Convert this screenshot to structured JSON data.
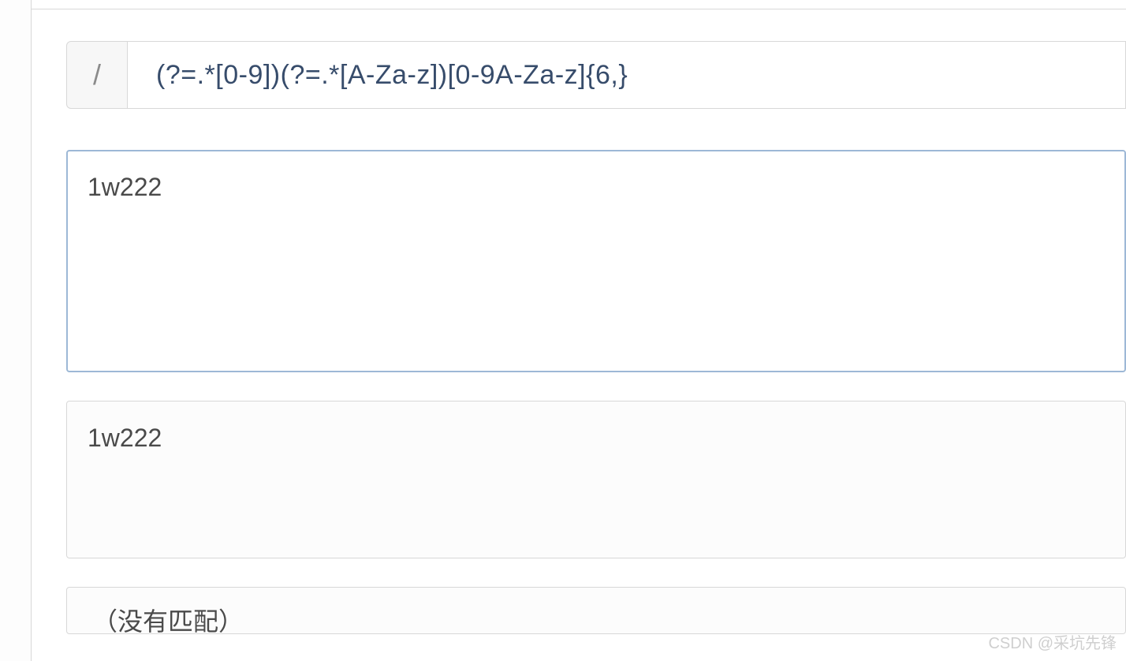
{
  "regex": {
    "delimiter": "/",
    "pattern": "(?=.*[0-9])(?=.*[A-Za-z])[0-9A-Za-z]{6,}"
  },
  "test_input": {
    "value": "1w222"
  },
  "result": {
    "text": "1w222"
  },
  "no_match": {
    "label": "（没有匹配）"
  },
  "watermark": "CSDN @采坑先锋"
}
